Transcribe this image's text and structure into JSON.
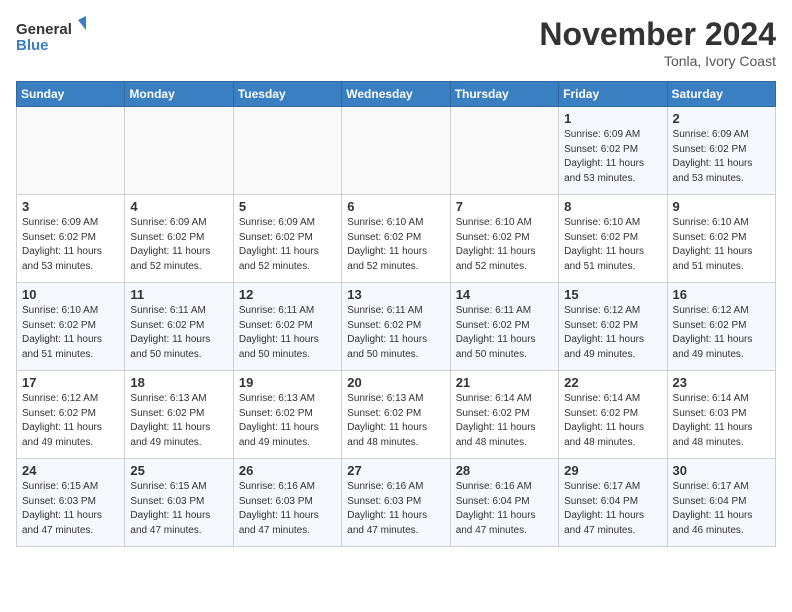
{
  "header": {
    "logo_line1": "General",
    "logo_line2": "Blue",
    "month_title": "November 2024",
    "subtitle": "Tonla, Ivory Coast"
  },
  "days_of_week": [
    "Sunday",
    "Monday",
    "Tuesday",
    "Wednesday",
    "Thursday",
    "Friday",
    "Saturday"
  ],
  "weeks": [
    [
      {
        "day": "",
        "info": ""
      },
      {
        "day": "",
        "info": ""
      },
      {
        "day": "",
        "info": ""
      },
      {
        "day": "",
        "info": ""
      },
      {
        "day": "",
        "info": ""
      },
      {
        "day": "1",
        "info": "Sunrise: 6:09 AM\nSunset: 6:02 PM\nDaylight: 11 hours\nand 53 minutes."
      },
      {
        "day": "2",
        "info": "Sunrise: 6:09 AM\nSunset: 6:02 PM\nDaylight: 11 hours\nand 53 minutes."
      }
    ],
    [
      {
        "day": "3",
        "info": "Sunrise: 6:09 AM\nSunset: 6:02 PM\nDaylight: 11 hours\nand 53 minutes."
      },
      {
        "day": "4",
        "info": "Sunrise: 6:09 AM\nSunset: 6:02 PM\nDaylight: 11 hours\nand 52 minutes."
      },
      {
        "day": "5",
        "info": "Sunrise: 6:09 AM\nSunset: 6:02 PM\nDaylight: 11 hours\nand 52 minutes."
      },
      {
        "day": "6",
        "info": "Sunrise: 6:10 AM\nSunset: 6:02 PM\nDaylight: 11 hours\nand 52 minutes."
      },
      {
        "day": "7",
        "info": "Sunrise: 6:10 AM\nSunset: 6:02 PM\nDaylight: 11 hours\nand 52 minutes."
      },
      {
        "day": "8",
        "info": "Sunrise: 6:10 AM\nSunset: 6:02 PM\nDaylight: 11 hours\nand 51 minutes."
      },
      {
        "day": "9",
        "info": "Sunrise: 6:10 AM\nSunset: 6:02 PM\nDaylight: 11 hours\nand 51 minutes."
      }
    ],
    [
      {
        "day": "10",
        "info": "Sunrise: 6:10 AM\nSunset: 6:02 PM\nDaylight: 11 hours\nand 51 minutes."
      },
      {
        "day": "11",
        "info": "Sunrise: 6:11 AM\nSunset: 6:02 PM\nDaylight: 11 hours\nand 50 minutes."
      },
      {
        "day": "12",
        "info": "Sunrise: 6:11 AM\nSunset: 6:02 PM\nDaylight: 11 hours\nand 50 minutes."
      },
      {
        "day": "13",
        "info": "Sunrise: 6:11 AM\nSunset: 6:02 PM\nDaylight: 11 hours\nand 50 minutes."
      },
      {
        "day": "14",
        "info": "Sunrise: 6:11 AM\nSunset: 6:02 PM\nDaylight: 11 hours\nand 50 minutes."
      },
      {
        "day": "15",
        "info": "Sunrise: 6:12 AM\nSunset: 6:02 PM\nDaylight: 11 hours\nand 49 minutes."
      },
      {
        "day": "16",
        "info": "Sunrise: 6:12 AM\nSunset: 6:02 PM\nDaylight: 11 hours\nand 49 minutes."
      }
    ],
    [
      {
        "day": "17",
        "info": "Sunrise: 6:12 AM\nSunset: 6:02 PM\nDaylight: 11 hours\nand 49 minutes."
      },
      {
        "day": "18",
        "info": "Sunrise: 6:13 AM\nSunset: 6:02 PM\nDaylight: 11 hours\nand 49 minutes."
      },
      {
        "day": "19",
        "info": "Sunrise: 6:13 AM\nSunset: 6:02 PM\nDaylight: 11 hours\nand 49 minutes."
      },
      {
        "day": "20",
        "info": "Sunrise: 6:13 AM\nSunset: 6:02 PM\nDaylight: 11 hours\nand 48 minutes."
      },
      {
        "day": "21",
        "info": "Sunrise: 6:14 AM\nSunset: 6:02 PM\nDaylight: 11 hours\nand 48 minutes."
      },
      {
        "day": "22",
        "info": "Sunrise: 6:14 AM\nSunset: 6:02 PM\nDaylight: 11 hours\nand 48 minutes."
      },
      {
        "day": "23",
        "info": "Sunrise: 6:14 AM\nSunset: 6:03 PM\nDaylight: 11 hours\nand 48 minutes."
      }
    ],
    [
      {
        "day": "24",
        "info": "Sunrise: 6:15 AM\nSunset: 6:03 PM\nDaylight: 11 hours\nand 47 minutes."
      },
      {
        "day": "25",
        "info": "Sunrise: 6:15 AM\nSunset: 6:03 PM\nDaylight: 11 hours\nand 47 minutes."
      },
      {
        "day": "26",
        "info": "Sunrise: 6:16 AM\nSunset: 6:03 PM\nDaylight: 11 hours\nand 47 minutes."
      },
      {
        "day": "27",
        "info": "Sunrise: 6:16 AM\nSunset: 6:03 PM\nDaylight: 11 hours\nand 47 minutes."
      },
      {
        "day": "28",
        "info": "Sunrise: 6:16 AM\nSunset: 6:04 PM\nDaylight: 11 hours\nand 47 minutes."
      },
      {
        "day": "29",
        "info": "Sunrise: 6:17 AM\nSunset: 6:04 PM\nDaylight: 11 hours\nand 47 minutes."
      },
      {
        "day": "30",
        "info": "Sunrise: 6:17 AM\nSunset: 6:04 PM\nDaylight: 11 hours\nand 46 minutes."
      }
    ]
  ]
}
